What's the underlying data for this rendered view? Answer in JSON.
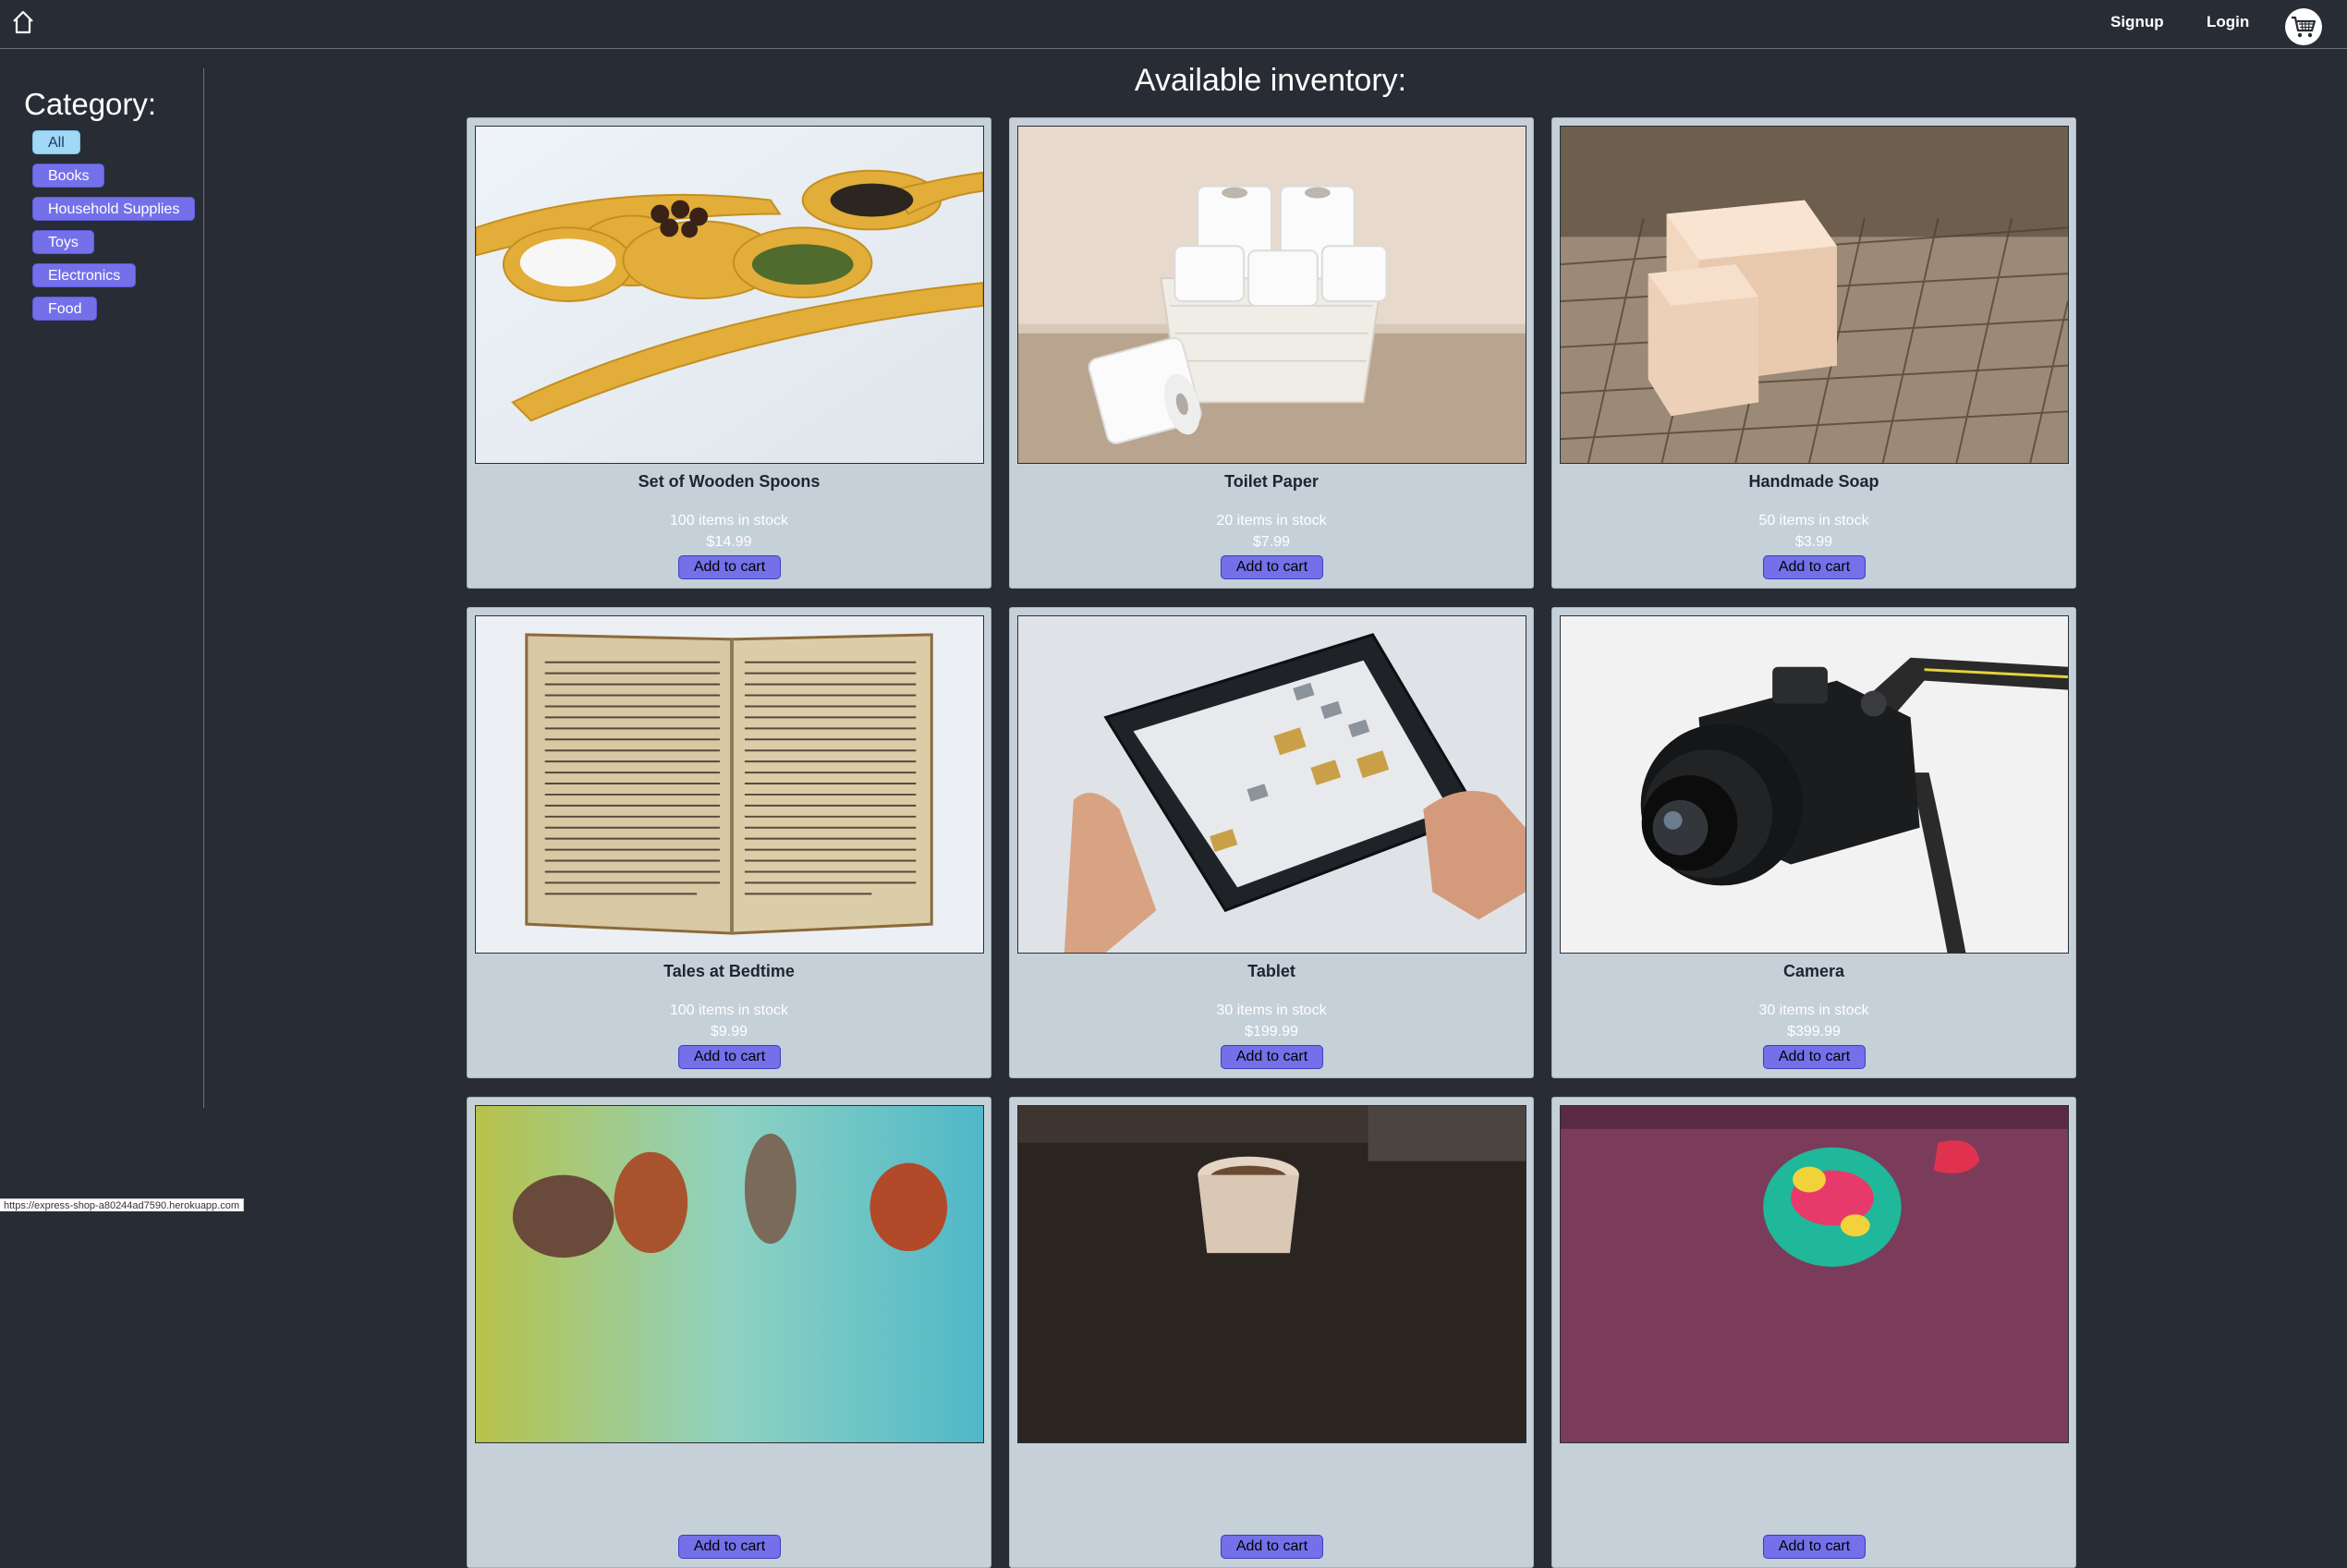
{
  "nav": {
    "signup": "Signup",
    "login": "Login"
  },
  "sidebar": {
    "title": "Category:",
    "categories": [
      {
        "label": "All",
        "active": true
      },
      {
        "label": "Books",
        "active": false
      },
      {
        "label": "Household Supplies",
        "active": false
      },
      {
        "label": "Toys",
        "active": false
      },
      {
        "label": "Electronics",
        "active": false
      },
      {
        "label": "Food",
        "active": false
      }
    ]
  },
  "main": {
    "title": "Available inventory:",
    "add_label": "Add to cart",
    "products": [
      {
        "name": "Set of Wooden Spoons",
        "stock": "100 items in stock",
        "price": "$14.99",
        "image": "wooden-spoons"
      },
      {
        "name": "Toilet Paper",
        "stock": "20 items in stock",
        "price": "$7.99",
        "image": "toilet-paper"
      },
      {
        "name": "Handmade Soap",
        "stock": "50 items in stock",
        "price": "$3.99",
        "image": "soap"
      },
      {
        "name": "Tales at Bedtime",
        "stock": "100 items in stock",
        "price": "$9.99",
        "image": "book"
      },
      {
        "name": "Tablet",
        "stock": "30 items in stock",
        "price": "$199.99",
        "image": "tablet"
      },
      {
        "name": "Camera",
        "stock": "30 items in stock",
        "price": "$399.99",
        "image": "camera"
      },
      {
        "name": "",
        "stock": "",
        "price": "",
        "image": "toy-figures"
      },
      {
        "name": "",
        "stock": "",
        "price": "",
        "image": "coffee"
      },
      {
        "name": "",
        "stock": "",
        "price": "",
        "image": "painted-toy"
      }
    ]
  },
  "status_bar": {
    "url": "https://express-shop-a80244ad7590.herokuapp.com"
  },
  "colors": {
    "background": "#282c34",
    "card": "#c6d0d9",
    "accent": "#7470ea",
    "active_category": "#a0d8f5"
  }
}
